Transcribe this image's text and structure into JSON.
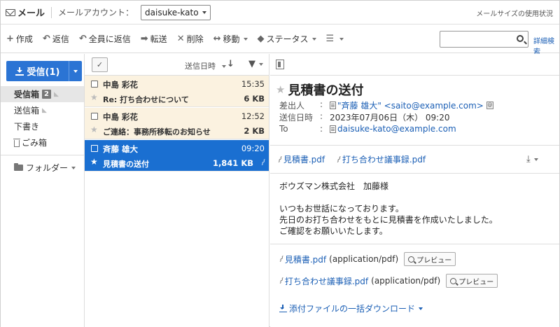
{
  "app": {
    "title": "メール",
    "account_label": "メールアカウント：",
    "account_value": "daisuke-kato",
    "usage_link": "メールサイズの使用状況"
  },
  "toolbar": {
    "compose": "作成",
    "reply": "返信",
    "reply_all": "全員に返信",
    "forward": "転送",
    "delete": "削除",
    "move": "移動",
    "status": "ステータス",
    "search_placeholder": "",
    "advanced_search": "詳細検索"
  },
  "sidebar": {
    "receive_button": "受信(1)",
    "folders": [
      {
        "label": "受信箱",
        "badge": "2"
      },
      {
        "label": "送信箱"
      },
      {
        "label": "下書き"
      },
      {
        "label": "ごみ箱"
      }
    ],
    "folder_menu": "フォルダー"
  },
  "list": {
    "sort_label": "送信日時",
    "messages": [
      {
        "from": "中島 彩花",
        "time": "15:35",
        "subject": "Re: 打ち合わせについて",
        "size": "6 KB"
      },
      {
        "from": "中島 彩花",
        "time": "12:52",
        "subject": "ご連絡：事務所移転のお知らせ",
        "size": "2 KB"
      },
      {
        "from": "斉藤 雄大",
        "time": "09:20",
        "subject": "見積書の送付",
        "size": "1,841 KB"
      }
    ]
  },
  "detail": {
    "subject": "見積書の送付",
    "from_label": "差出人",
    "from_value": "\"斉藤 雄大\" <saito@example.com>",
    "date_label": "送信日時",
    "date_value": "2023年07月06日（木） 09:20",
    "to_label": "To",
    "to_value": "daisuke-kato@example.com",
    "attachments": [
      "見積書.pdf",
      "打ち合わせ議事録.pdf"
    ],
    "body_lines": [
      "ボウズマン株式会社　加藤様",
      "",
      "いつもお世話になっております。",
      "先日のお打ち合わせをもとに見積書を作成いたしました。",
      "ご確認をお願いいたします。"
    ],
    "att_mime": "(application/pdf)",
    "preview_label": "プレビュー",
    "bulk_download": "添付ファイルの一括ダウンロード"
  },
  "colors": {
    "accent": "#2b74d4",
    "selected_row": "#1a6fd1",
    "read_row": "#fbf2e0",
    "link": "#1b5fb5"
  }
}
